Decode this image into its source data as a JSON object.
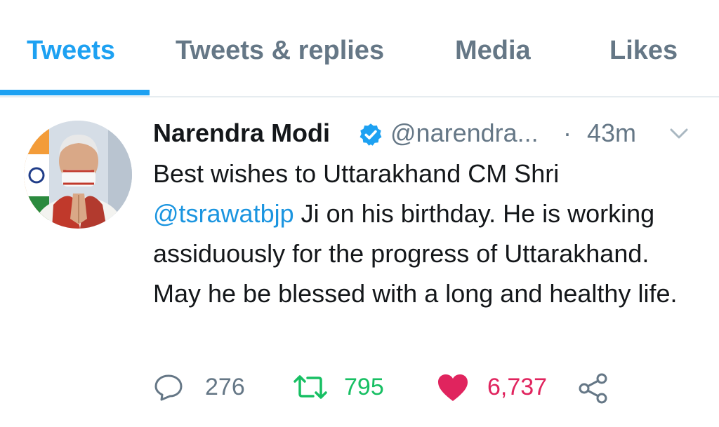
{
  "tabs": [
    {
      "label": "Tweets",
      "active": true
    },
    {
      "label": "Tweets & replies",
      "active": false
    },
    {
      "label": "Media",
      "active": false
    },
    {
      "label": "Likes",
      "active": false
    }
  ],
  "colors": {
    "accent": "#1da1f2",
    "muted": "#657786",
    "text": "#14171a",
    "retweet": "#17bf63",
    "like": "#e0245e"
  },
  "tweet": {
    "author_name": "Narendra Modi",
    "verified_icon": "verified-badge-icon",
    "handle": "@narendra...",
    "separator": "·",
    "time": "43m",
    "text_part1": "Best wishes to Uttarakhand CM Shri ",
    "mention": "@tsrawatbjp",
    "text_part2": " Ji on his birthday. He is working assiduously for the progress of Uttarakhand. May he be blessed with a long and healthy life.",
    "replies": "276",
    "retweets": "795",
    "likes": "6,737",
    "icons": [
      "reply-icon",
      "retweet-icon",
      "heart-icon",
      "share-icon",
      "chevron-down-icon"
    ]
  }
}
